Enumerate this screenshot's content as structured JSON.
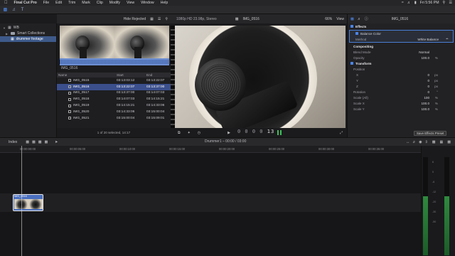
{
  "menubar": {
    "app_name": "Final Cut Pro",
    "items": [
      "File",
      "Edit",
      "Trim",
      "Mark",
      "Clip",
      "Modify",
      "View",
      "Window",
      "Help"
    ],
    "clock": "Fri 5:56 PM"
  },
  "browser": {
    "filter": "Hide Rejected",
    "filmstrip_label": "IMG_0516",
    "columns": [
      "Name",
      "Start",
      "End"
    ],
    "rows": [
      {
        "name": "IMG_0515",
        "start": "03:13:03:12",
        "end": "03:13:22:07"
      },
      {
        "name": "IMG_0516",
        "start": "03:13:22:07",
        "end": "03:13:37:00"
      },
      {
        "name": "IMG_0517",
        "start": "03:13:37:00",
        "end": "03:14:07:03"
      },
      {
        "name": "IMG_0518",
        "start": "03:14:07:03",
        "end": "03:14:15:21"
      },
      {
        "name": "IMG_0519",
        "start": "03:14:15:21",
        "end": "03:14:33:06"
      },
      {
        "name": "IMG_0520",
        "start": "03:14:33:06",
        "end": "03:15:00:04"
      },
      {
        "name": "IMG_0521",
        "start": "03:15:00:04",
        "end": "03:15:09:01"
      }
    ],
    "selected_row": 1,
    "status": "1 of 20 selected, 14:17"
  },
  "sidebar": {
    "library": "WB",
    "items": [
      "Smart Collections",
      "drummer footage"
    ]
  },
  "viewer": {
    "format": "1080p HD 23.98p, Stereo",
    "clip_name": "IMG_0516",
    "zoom": "66%",
    "view_label": "View",
    "timecode_dim": "0 0 0 0",
    "timecode_frame": "13"
  },
  "inspector": {
    "clip_name": "IMG_0516",
    "sections": {
      "effects": "Effects",
      "balance": "Balance Color",
      "method_label": "Method",
      "method_value": "White Balance",
      "compositing": "Compositing",
      "blend_label": "Blend Mode",
      "blend_value": "Normal",
      "opacity_label": "Opacity",
      "opacity_value": "100.0",
      "transform": "Transform",
      "position_label": "Position",
      "x_label": "X",
      "x_value": "0",
      "y_label": "Y",
      "y_value": "0",
      "z_label": "Z",
      "z_value": "0",
      "rotation_label": "Rotation",
      "rotation_value": "0",
      "scale_all_label": "Scale (All)",
      "scale_all_value": "100",
      "scale_x_label": "Scale X",
      "scale_x_value": "100.0",
      "scale_y_label": "Scale Y",
      "scale_y_value": "100.0"
    },
    "units": {
      "percent": "%",
      "px": "px",
      "deg": "°"
    },
    "save_preset": "Save Effects Preset"
  },
  "timeline": {
    "index_label": "Index",
    "title": "Drummer1 – 00:00 / 03:00",
    "ruler_labels": [
      "00:00:00:00",
      "00:00:05:00",
      "00:00:10:00",
      "00:00:15:00",
      "00:00:20:00",
      "00:00:25:00",
      "00:00:30:00",
      "00:00:35:00"
    ],
    "clip_label": "IMG_0516"
  },
  "meters": {
    "scale": [
      "6",
      "0",
      "-6",
      "-12",
      "-20",
      "-30",
      "-50"
    ],
    "levels": [
      0.6,
      0.6
    ]
  },
  "colors": {
    "accent": "#4d8bf0",
    "selection": "#3b4f8c",
    "clip": "#4a6fbf"
  }
}
